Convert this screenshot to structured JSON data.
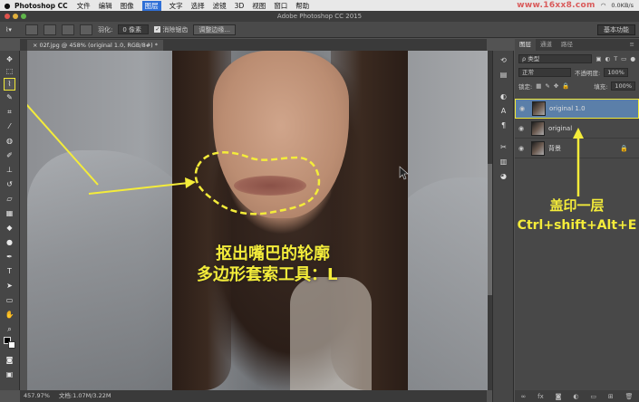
{
  "menubar": {
    "apple_icon": "apple-icon",
    "app_name": "Photoshop CC",
    "items": [
      "文件",
      "编辑",
      "图像",
      "图层",
      "文字",
      "选择",
      "滤镜",
      "3D",
      "视图",
      "窗口",
      "帮助"
    ],
    "active_item": "图层",
    "watermark": "www.16xx8.com",
    "net_speed": "0.0KB/s"
  },
  "window": {
    "title": "Adobe Photoshop CC 2015"
  },
  "options": {
    "feather_label": "羽化:",
    "feather_value": "0 像素",
    "antialias_label": "消除锯齿",
    "refine_edge_button": "调整边缘...",
    "workspace": "基本功能"
  },
  "document_tab": {
    "label": "02f.jpg @ 458% (original 1.0, RGB/8#) *"
  },
  "annotations": {
    "caption_line1": "抠出嘴巴的轮廓",
    "caption_line2": "多边形套索工具：L",
    "panel_caption_line1": "盖印一层",
    "panel_caption_line2": "Ctrl+shift+Alt+E",
    "accent_color": "#f4ec3a"
  },
  "status": {
    "zoom": "457.97%",
    "doc_size": "文档:1.07M/3.22M"
  },
  "layers_panel": {
    "tabs": [
      "图层",
      "通道",
      "路径"
    ],
    "active_tab": "图层",
    "filter_kind": "ρ 类型",
    "blend_mode": "正常",
    "opacity_label": "不透明度:",
    "opacity_value": "100%",
    "lock_label": "锁定:",
    "fill_label": "填充:",
    "fill_value": "100%",
    "layers": [
      {
        "name": "original 1.0",
        "visible": true,
        "selected": true,
        "locked": false
      },
      {
        "name": "original",
        "visible": true,
        "selected": false,
        "locked": false
      },
      {
        "name": "背景",
        "visible": true,
        "selected": false,
        "locked": true
      }
    ]
  }
}
